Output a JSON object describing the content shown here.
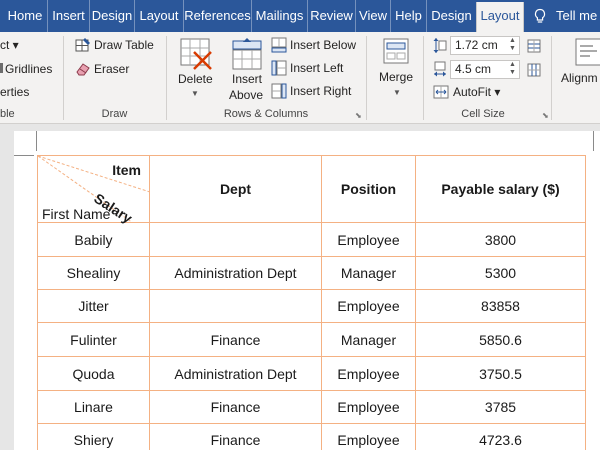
{
  "tabs": [
    {
      "label": "Home",
      "active": false
    },
    {
      "label": "Insert",
      "active": false
    },
    {
      "label": "Design",
      "active": false
    },
    {
      "label": "Layout",
      "active": false
    },
    {
      "label": "References",
      "active": false
    },
    {
      "label": "Mailings",
      "active": false
    },
    {
      "label": "Review",
      "active": false
    },
    {
      "label": "View",
      "active": false
    },
    {
      "label": "Help",
      "active": false
    },
    {
      "label": "Design",
      "active": false
    },
    {
      "label": "Layout",
      "active": true
    }
  ],
  "tell_me": "Tell me",
  "ribbon": {
    "table_group": {
      "select": "ct",
      "gridlines": "Gridlines",
      "properties": "erties",
      "label": "ble"
    },
    "draw_group": {
      "draw_table": "Draw Table",
      "eraser": "Eraser",
      "label": "Draw"
    },
    "rows_cols_group": {
      "delete": "Delete",
      "insert_above_1": "Insert",
      "insert_above_2": "Above",
      "insert_below": "Insert Below",
      "insert_left": "Insert Left",
      "insert_right": "Insert Right",
      "label": "Rows & Columns"
    },
    "merge_group": {
      "merge": "Merge"
    },
    "cell_size_group": {
      "height": "1.72 cm",
      "width": "4.5 cm",
      "autofit": "AutoFit",
      "label": "Cell Size"
    },
    "alignment_group": {
      "alignment": "Alignm"
    }
  },
  "table": {
    "diagonal_header": {
      "top": "Item",
      "middle": "Salary",
      "bottom": "First Name"
    },
    "headers": [
      "Dept",
      "Position",
      "Payable salary ($)"
    ],
    "rows": [
      {
        "name": "Babily",
        "dept": "",
        "position": "Employee",
        "salary": "3800"
      },
      {
        "name": "Shealiny",
        "dept": "Administration Dept",
        "position": "Manager",
        "salary": "5300"
      },
      {
        "name": "Jitter",
        "dept": "",
        "position": "Employee",
        "salary": "83858"
      },
      {
        "name": "Fulinter",
        "dept": "Finance",
        "position": "Manager",
        "salary": "5850.6"
      },
      {
        "name": "Quoda",
        "dept": "Administration Dept",
        "position": "Employee",
        "salary": "3750.5"
      },
      {
        "name": "Linare",
        "dept": "Finance",
        "position": "Employee",
        "salary": "3785"
      },
      {
        "name": "Shiery",
        "dept": "Finance",
        "position": "Employee",
        "salary": "4723.6"
      }
    ]
  }
}
